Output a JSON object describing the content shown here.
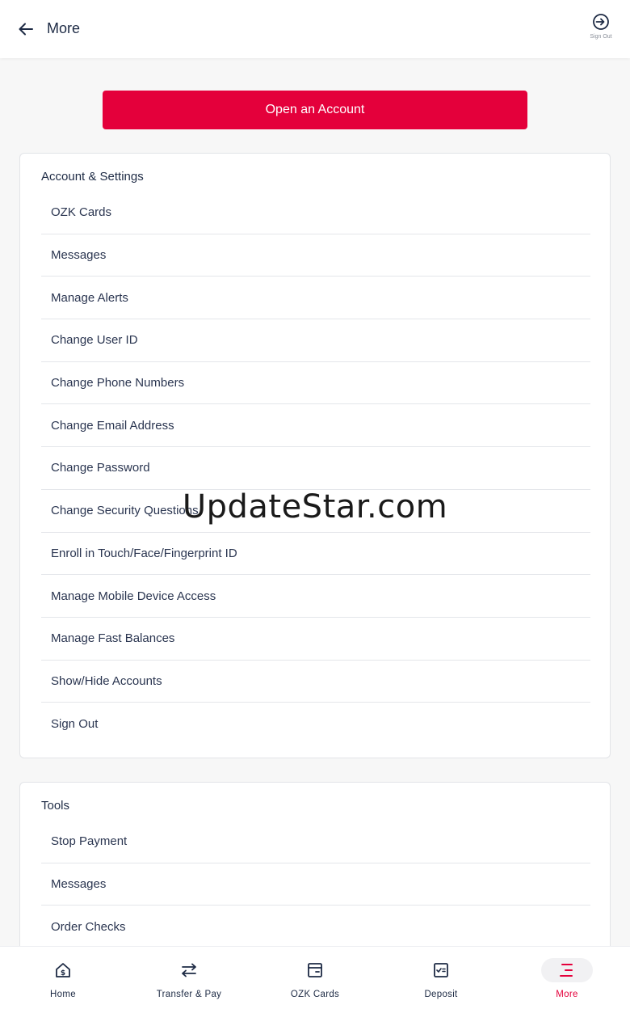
{
  "header": {
    "title": "More",
    "back_icon": "arrow-left-icon",
    "signout_label": "Sign Out"
  },
  "open_account": {
    "label": "Open an Account",
    "color": "#e4003b"
  },
  "account_settings": {
    "title": "Account & Settings",
    "items": [
      "OZK Cards",
      "Messages",
      "Manage Alerts",
      "Change User ID",
      "Change Phone Numbers",
      "Change Email Address",
      "Change Password",
      "Change Security Questions",
      "Enroll in Touch/Face/Fingerprint ID",
      "Manage Mobile Device Access",
      "Manage Fast Balances",
      "Show/Hide Accounts",
      "Sign Out"
    ]
  },
  "tools": {
    "title": "Tools",
    "items": [
      "Stop Payment",
      "Messages",
      "Order Checks"
    ]
  },
  "watermark": "UpdateStar.com",
  "bottom_nav": {
    "items": [
      {
        "label": "Home",
        "icon": "home-dollar-icon"
      },
      {
        "label": "Transfer & Pay",
        "icon": "transfer-arrows-icon"
      },
      {
        "label": "OZK Cards",
        "icon": "card-icon"
      },
      {
        "label": "Deposit",
        "icon": "check-deposit-icon"
      },
      {
        "label": "More",
        "icon": "menu-icon",
        "active": true
      }
    ]
  }
}
